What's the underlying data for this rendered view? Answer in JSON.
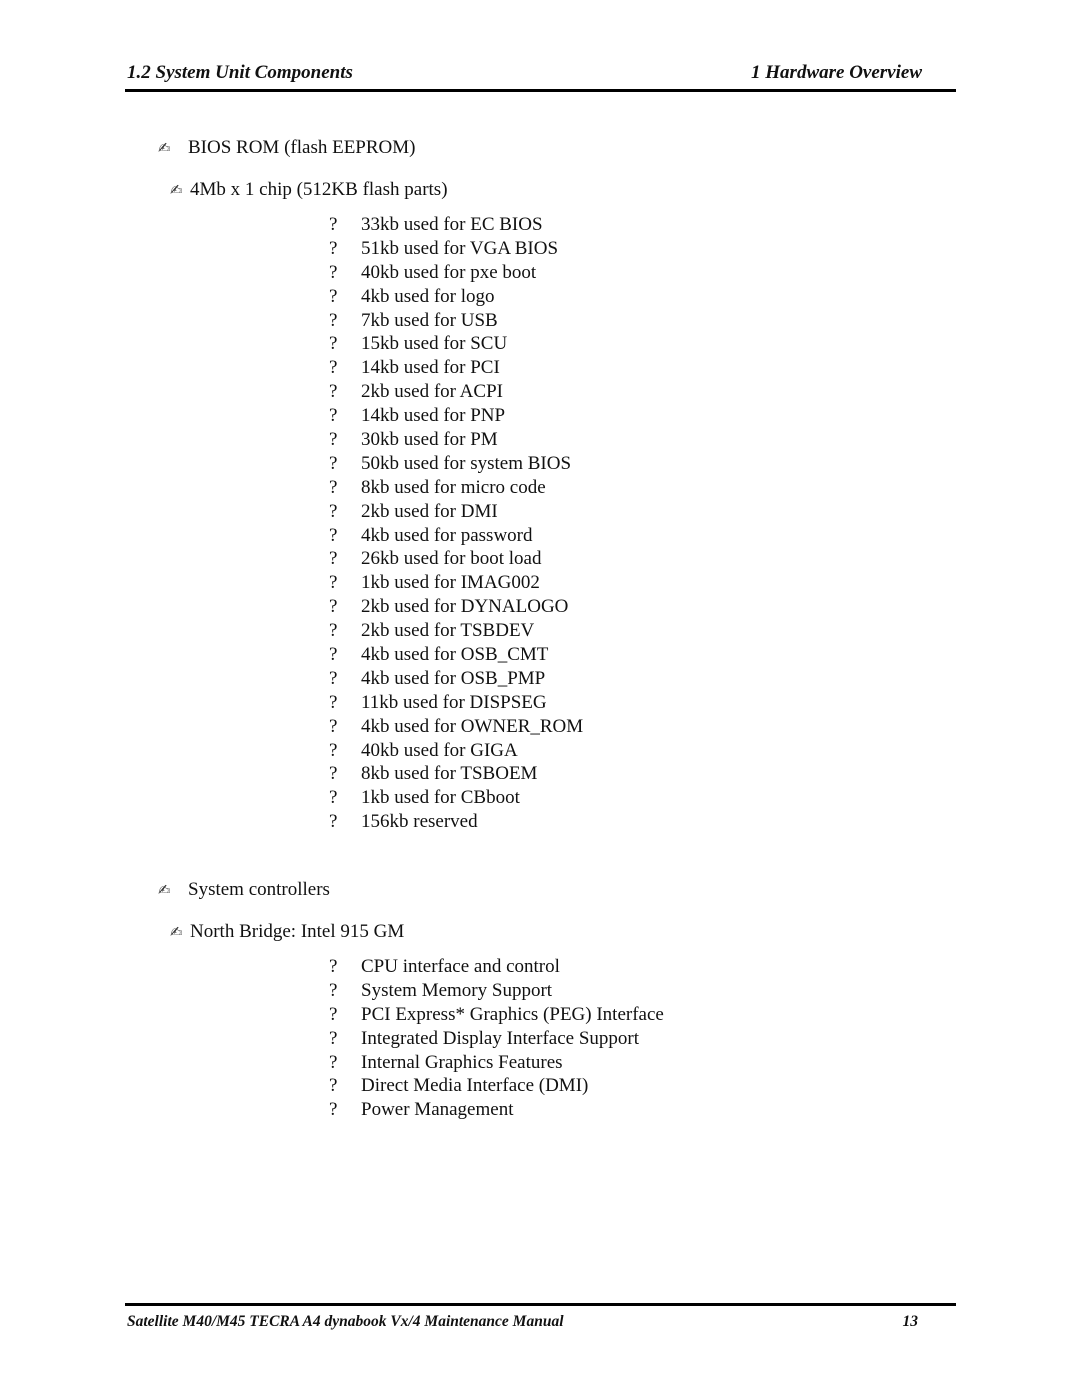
{
  "header": {
    "section": "1.2 System Unit Components",
    "chapter": "1  Hardware Overview"
  },
  "bios": {
    "bullet_icon": "writing-hand-icon",
    "bullet_glyph": "✍",
    "title": "BIOS ROM (flash EEPROM)",
    "chip": "4Mb x 1 chip (512KB flash parts)",
    "item_marker": "?",
    "items": [
      "33kb used for EC BIOS",
      "51kb used for VGA BIOS",
      "40kb used for pxe boot",
      "4kb used for logo",
      "7kb used for USB",
      "15kb used for SCU",
      "14kb used for PCI",
      "2kb used for ACPI",
      "14kb used for PNP",
      "30kb used for PM",
      "50kb used for system BIOS",
      "8kb used for micro code",
      "2kb used for DMI",
      "4kb used for password",
      "26kb used for boot load",
      "1kb used for IMAG002",
      "2kb used for DYNALOGO",
      "2kb used for TSBDEV",
      "4kb used for OSB_CMT",
      "4kb used for OSB_PMP",
      "11kb used for DISPSEG",
      "4kb used for OWNER_ROM",
      "40kb used for GIGA",
      "8kb used for TSBOEM",
      "1kb used for CBboot",
      "156kb reserved"
    ]
  },
  "controllers": {
    "bullet_glyph": "✍",
    "title": "System controllers",
    "north_bridge": "North Bridge: Intel 915 GM",
    "item_marker": "?",
    "items": [
      "CPU interface and control",
      "System Memory Support",
      "PCI Express* Graphics (PEG) Interface",
      "Integrated Display Interface Support",
      "Internal Graphics Features",
      "Direct Media Interface (DMI)",
      "Power Management"
    ]
  },
  "footer": {
    "manual_title": "Satellite M40/M45 TECRA A4 dynabook Vx/4  Maintenance Manual",
    "page_number": "13"
  }
}
